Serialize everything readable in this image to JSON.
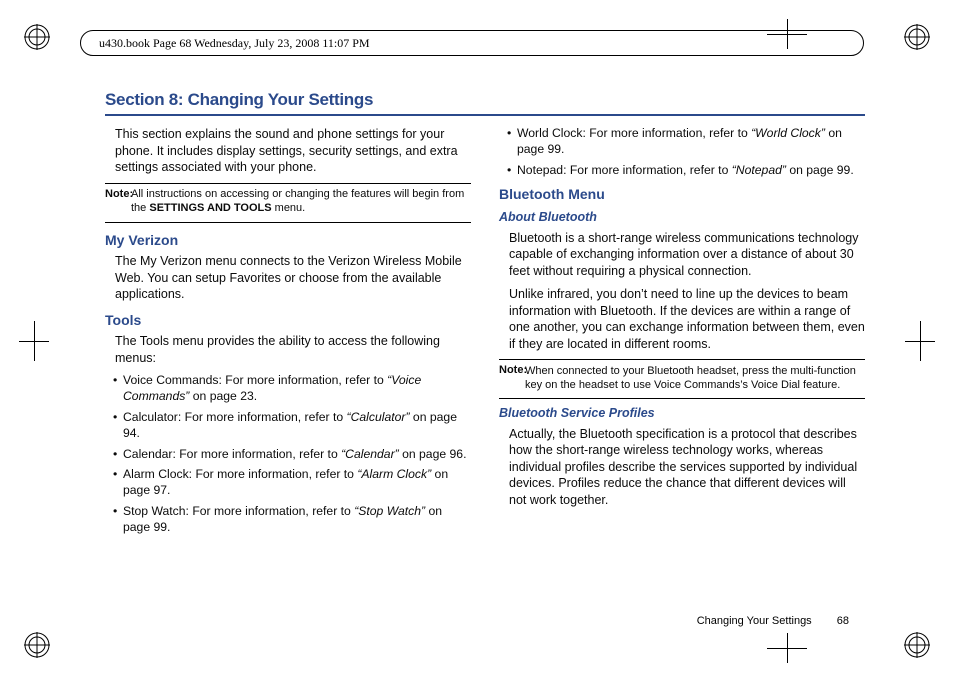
{
  "header": {
    "stamp": "u430.book  Page 68  Wednesday, July 23, 2008  11:07 PM"
  },
  "section": {
    "title": "Section 8: Changing Your Settings"
  },
  "left": {
    "intro": "This section explains the sound and phone settings for your phone. It includes display settings, security settings, and extra settings associated with your phone.",
    "note": {
      "label": "Note:",
      "pre": "All instructions on accessing or changing the features will begin from the ",
      "strong": "SETTINGS AND TOOLS",
      "post": " menu."
    },
    "my_verizon": {
      "heading": "My Verizon",
      "body": "The My Verizon menu connects to the Verizon Wireless Mobile Web. You can setup Favorites or choose from the available applications."
    },
    "tools": {
      "heading": "Tools",
      "intro": "The Tools menu provides the ability to access the following menus:",
      "items": [
        {
          "pre": "Voice Commands: For more information, refer to ",
          "ref": "“Voice Commands”",
          "post": "  on page 23."
        },
        {
          "pre": "Calculator: For more information, refer to ",
          "ref": "“Calculator”",
          "post": "  on page 94."
        },
        {
          "pre": "Calendar: For more information, refer to ",
          "ref": "“Calendar”",
          "post": "  on page 96."
        },
        {
          "pre": "Alarm Clock: For more information, refer to ",
          "ref": "“Alarm Clock”",
          "post": "  on page 97."
        },
        {
          "pre": "Stop Watch: For more information, refer to ",
          "ref": "“Stop Watch”",
          "post": "  on page 99."
        }
      ]
    }
  },
  "right": {
    "cont_items": [
      {
        "pre": "World Clock: For more information, refer to ",
        "ref": "“World Clock”",
        "post": "  on page 99."
      },
      {
        "pre": "Notepad: For more information, refer to ",
        "ref": "“Notepad”",
        "post": "  on page 99."
      }
    ],
    "bt_menu": {
      "heading": "Bluetooth Menu"
    },
    "about": {
      "heading": "About Bluetooth",
      "p1": "Bluetooth is a short-range wireless communications technology capable of exchanging information over a distance of about 30 feet without requiring a physical connection.",
      "p2": "Unlike infrared, you don’t need to line up the devices to beam information with Bluetooth. If the devices are within a range of one another, you can exchange information between them, even if they are located in different rooms."
    },
    "note": {
      "label": "Note:",
      "body": "When connected to your Bluetooth headset, press the multi-function key on the headset to use Voice Commands’s Voice Dial feature."
    },
    "profiles": {
      "heading": "Bluetooth Service Profiles",
      "body": "Actually, the Bluetooth specification is a protocol that describes how the short-range wireless technology works, whereas individual profiles describe the services supported by individual devices. Profiles reduce the chance that different devices will not work together."
    }
  },
  "footer": {
    "label": "Changing Your Settings",
    "page": "68"
  }
}
